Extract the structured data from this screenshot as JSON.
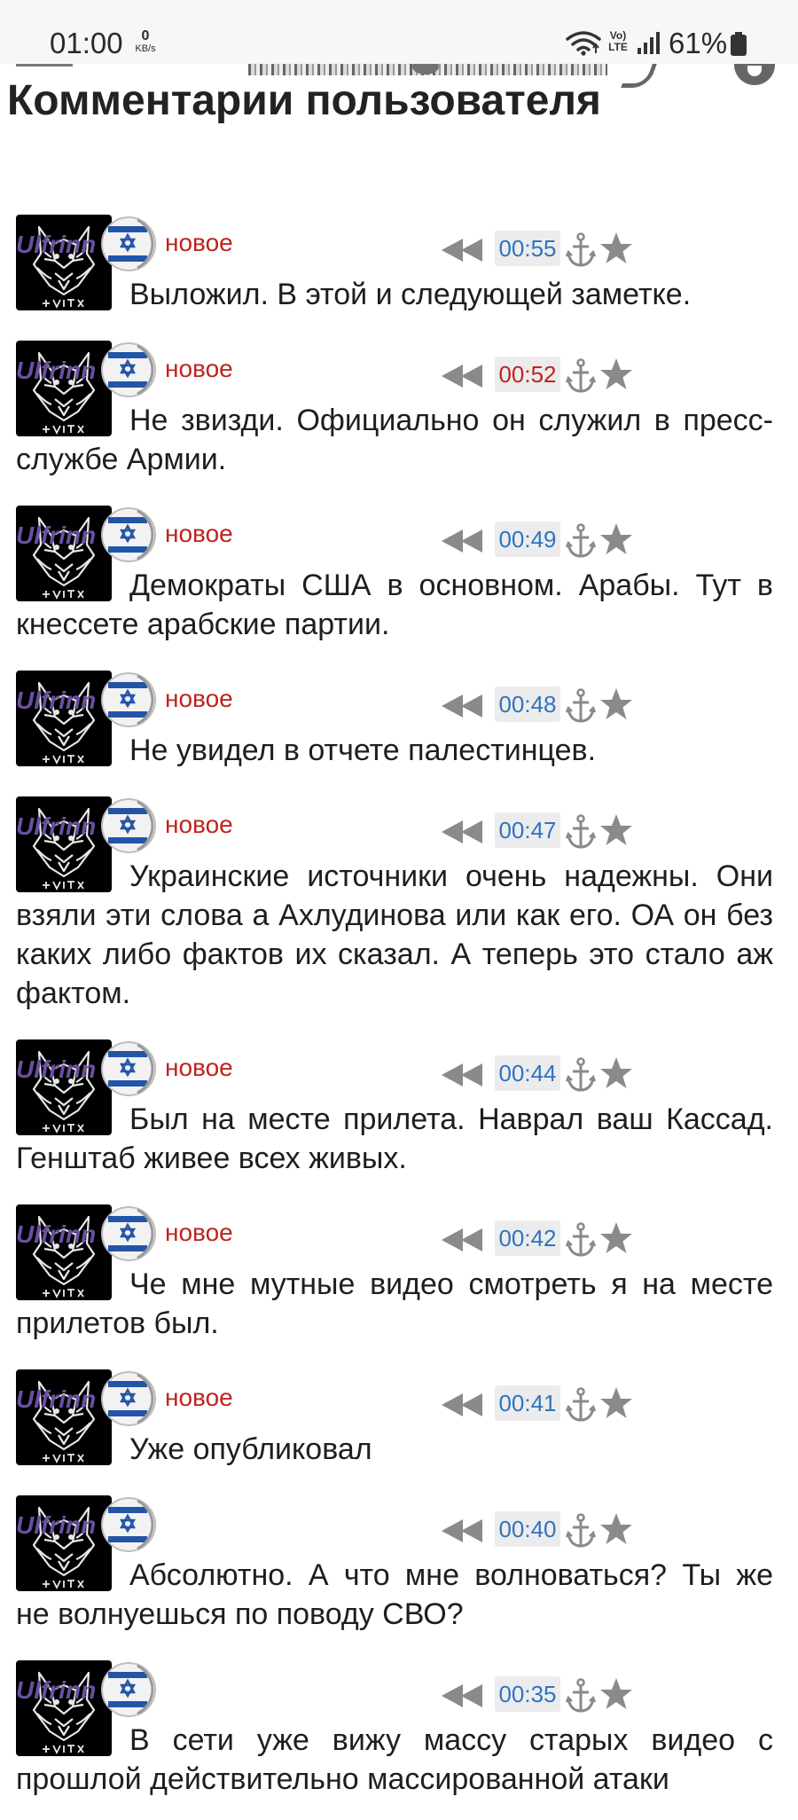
{
  "status_bar": {
    "time": "01:00",
    "net_speed_value": "0",
    "net_speed_unit": "KB/s",
    "volte_top": "Vo)",
    "volte_bottom": "LTE",
    "battery": "61%"
  },
  "page": {
    "title": "Комментарии пользователя"
  },
  "icons": {
    "wifi": "wifi-icon",
    "signal": "signal-icon",
    "battery": "battery-icon",
    "avatar": "wolf-logo-avatar",
    "flag": "israel-flag-icon",
    "reply": "reply-arrows-icon",
    "anchor": "anchor-icon",
    "star": "star-icon"
  },
  "colors": {
    "username": "#6a4fa0",
    "new_badge": "#c0231f",
    "time_blue": "#2f74c0",
    "time_red": "#c0231f"
  },
  "comments": [
    {
      "user": "Ulfrinn",
      "status": "новое",
      "time": "00:55",
      "time_color": "blue",
      "text": "Выложил. В этой и следующей заметке."
    },
    {
      "user": "Ulfrinn",
      "status": "новое",
      "time": "00:52",
      "time_color": "red",
      "text": "Не звизди. Официально он служил в пресс-службе Армии."
    },
    {
      "user": "Ulfrinn",
      "status": "новое",
      "time": "00:49",
      "time_color": "blue",
      "text": "Демократы США в основном. Арабы. Тут в кнессете арабские партии."
    },
    {
      "user": "Ulfrinn",
      "status": "новое",
      "time": "00:48",
      "time_color": "blue",
      "text": "Не увидел в отчете палестинцев."
    },
    {
      "user": "Ulfrinn",
      "status": "новое",
      "time": "00:47",
      "time_color": "blue",
      "text": "Украинские источники очень надежны. Они взяли эти слова а Ахлудинова или как его. ОА он без каких либо фактов их сказал. А теперь это стало аж фактом."
    },
    {
      "user": "Ulfrinn",
      "status": "новое",
      "time": "00:44",
      "time_color": "blue",
      "text": "Был на месте прилета. Наврал ваш Кассад. Генштаб живее всех живых."
    },
    {
      "user": "Ulfrinn",
      "status": "новое",
      "time": "00:42",
      "time_color": "blue",
      "text": "Че мне мутные видео смотреть я на месте прилетов был."
    },
    {
      "user": "Ulfrinn",
      "status": "новое",
      "time": "00:41",
      "time_color": "blue",
      "text": "Уже опубликовал"
    },
    {
      "user": "Ulfrinn",
      "status": "",
      "time": "00:40",
      "time_color": "blue",
      "text": "Абсолютно. А что мне волноваться? Ты же не волнуешься по поводу СВО?"
    },
    {
      "user": "Ulfrinn",
      "status": "",
      "time": "00:35",
      "time_color": "blue",
      "text": "В сети уже вижу массу старых видео с прошлой действительно массированной атаки"
    }
  ]
}
